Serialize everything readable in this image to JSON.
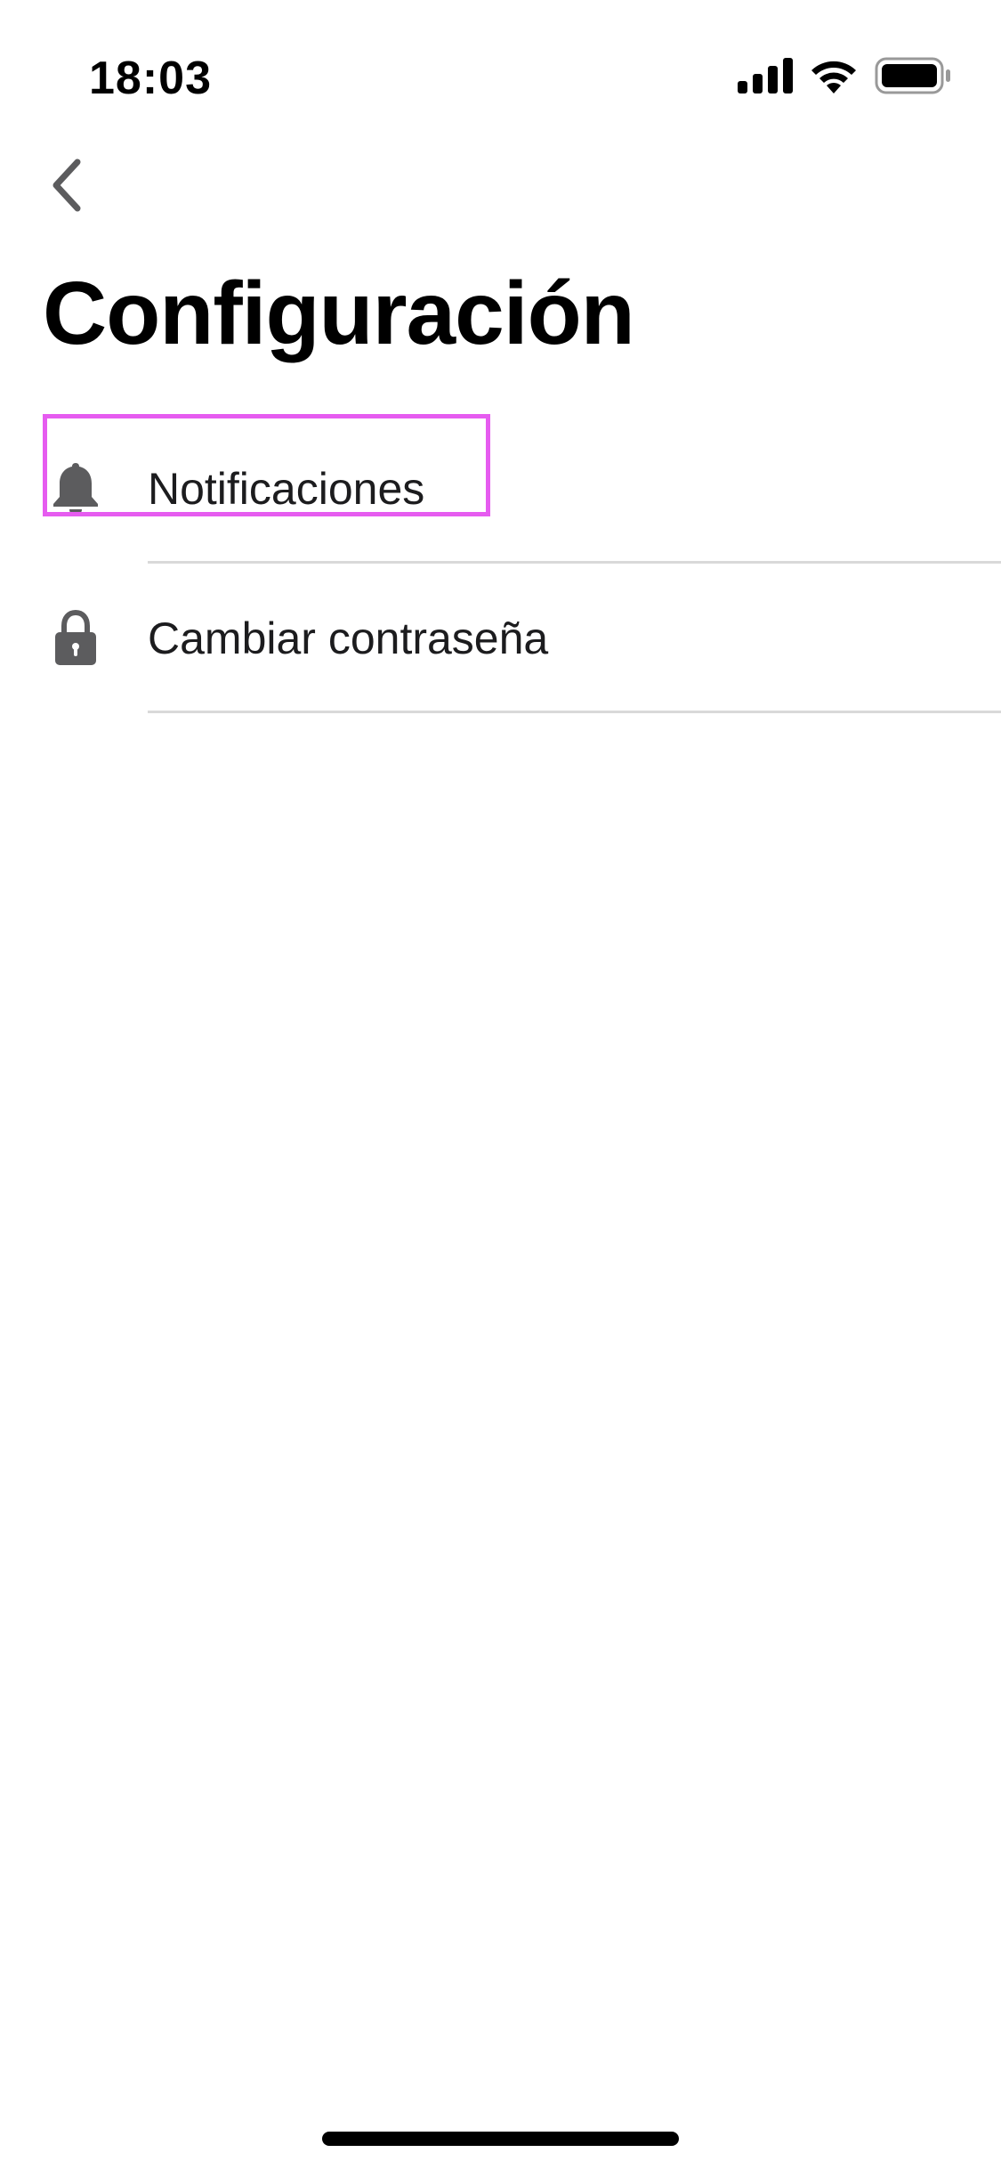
{
  "status_bar": {
    "time": "18:03",
    "icons": [
      "cellular-signal-icon",
      "wifi-icon",
      "battery-icon"
    ]
  },
  "navigation": {
    "back_icon": "chevron-left-icon"
  },
  "page": {
    "title": "Configuración"
  },
  "settings": {
    "items": [
      {
        "label": "Notificaciones",
        "icon": "bell-icon",
        "highlighted": true
      },
      {
        "label": "Cambiar contraseña",
        "icon": "lock-icon",
        "highlighted": false
      }
    ]
  },
  "colors": {
    "highlight": "#e65cf0",
    "icon": "#5c5c5e",
    "divider": "#d9d9d9",
    "text": "#1c1c1e"
  }
}
